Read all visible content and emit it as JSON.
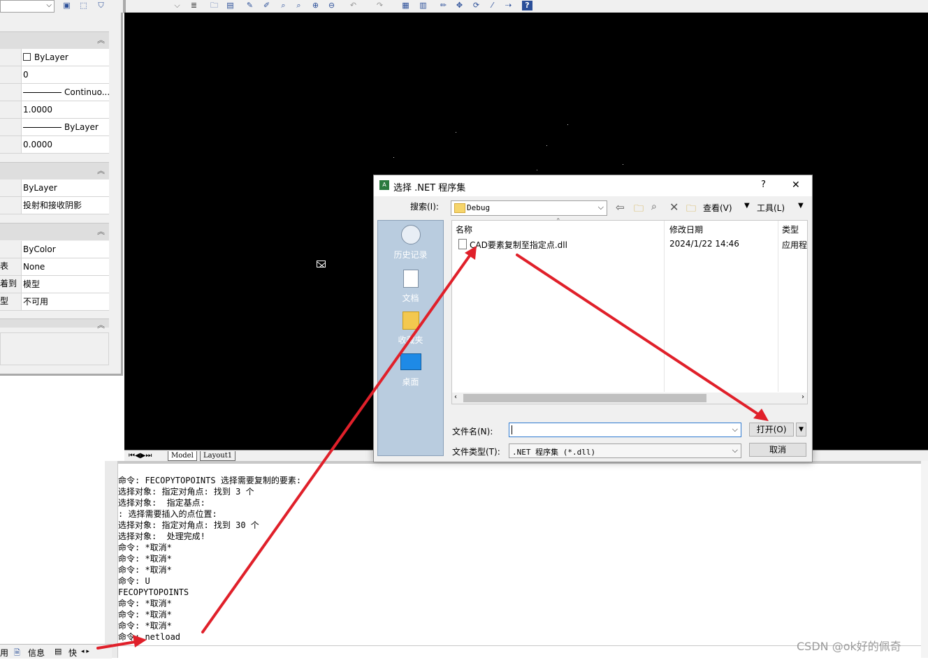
{
  "palette": {
    "section1": [
      {
        "key": "",
        "value": "ByLayer",
        "has_swatch": true
      },
      {
        "key": "",
        "value": "0"
      },
      {
        "key": "",
        "value": "Continuo...",
        "has_line": true
      },
      {
        "key": "",
        "value": "1.0000"
      },
      {
        "key": "",
        "value": "ByLayer",
        "has_line": true
      },
      {
        "key": "",
        "value": "0.0000"
      }
    ],
    "section2": [
      {
        "key": "",
        "value": "ByLayer"
      },
      {
        "key": "",
        "value": "投射和接收阴影"
      }
    ],
    "section3": [
      {
        "key": "",
        "value": "ByColor"
      },
      {
        "key": "表",
        "value": "None"
      },
      {
        "key": "着到",
        "value": "模型"
      },
      {
        "key": "型",
        "value": "不可用"
      }
    ]
  },
  "layout_tabs": {
    "model": "Model",
    "layout1": "Layout1"
  },
  "dialog": {
    "title": "选择 .NET 程序集",
    "help": "?",
    "close": "✕",
    "search_label": "搜索(I):",
    "search_value": "Debug",
    "view_label": "查看(V)",
    "tools_label": "工具(L)",
    "places": [
      "历史记录",
      "文档",
      "收藏夹",
      "桌面"
    ],
    "columns": [
      "名称",
      "修改日期",
      "类型"
    ],
    "files": [
      {
        "name": "CAD要素复制至指定点.dll",
        "date": "2024/1/22 14:46",
        "type": "应用程"
      }
    ],
    "filename_label": "文件名(N):",
    "filename_value": "",
    "filetype_label": "文件类型(T):",
    "filetype_value": ".NET 程序集 (*.dll)",
    "open_button": "打开(O)",
    "cancel_button": "取消"
  },
  "command_lines": [
    "命令: FECOPYTOPOINTS 选择需要复制的要素:",
    "选择对象: 指定对角点: 找到 3 个",
    "选择对象:  指定基点:",
    ": 选择需要插入的点位置:",
    "选择对象: 指定对角点: 找到 30 个",
    "选择对象:  处理完成!",
    "命令: *取消*",
    "命令: *取消*",
    "命令: *取消*",
    "命令: U",
    "FECOPYTOPOINTS",
    "命令: *取消*",
    "命令: *取消*",
    "命令: *取消*",
    "命令: netload"
  ],
  "bottom_tabs": {
    "left": "用",
    "info": "信息",
    "quick": "快"
  },
  "watermark": "CSDN @ok好的佩奇",
  "colors": {
    "arrow": "#e0202a",
    "canvas": "#000000"
  }
}
